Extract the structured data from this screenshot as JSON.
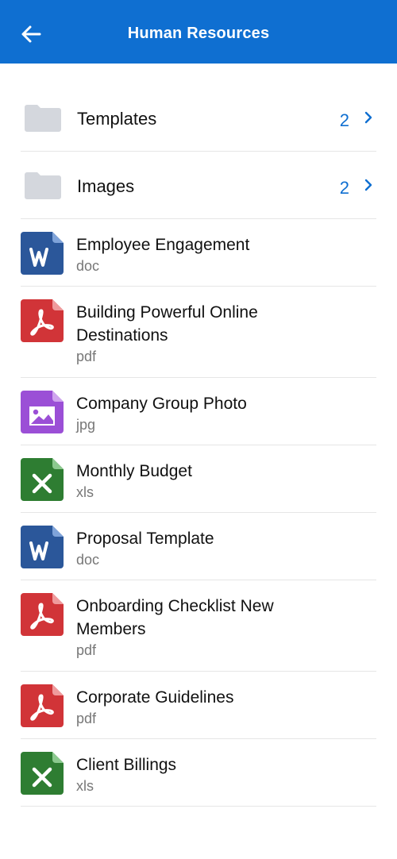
{
  "header": {
    "title": "Human Resources",
    "back_icon": "arrow-left-icon",
    "background": "#0f6fd1"
  },
  "folders": [
    {
      "name": "Templates",
      "count": "2"
    },
    {
      "name": "Images",
      "count": "2"
    }
  ],
  "files": [
    {
      "name": "Employee Engagement",
      "ext": "doc",
      "icon": "word-icon"
    },
    {
      "name": "Building Powerful Online Destinations",
      "ext": "pdf",
      "icon": "pdf-icon"
    },
    {
      "name": "Company Group Photo",
      "ext": "jpg",
      "icon": "image-icon"
    },
    {
      "name": "Monthly Budget",
      "ext": "xls",
      "icon": "excel-icon"
    },
    {
      "name": "Proposal Template",
      "ext": "doc",
      "icon": "word-icon"
    },
    {
      "name": "Onboarding Checklist New Members",
      "ext": "pdf",
      "icon": "pdf-icon"
    },
    {
      "name": "Corporate Guidelines",
      "ext": "pdf",
      "icon": "pdf-icon"
    },
    {
      "name": "Client Billings",
      "ext": "xls",
      "icon": "excel-icon"
    }
  ],
  "colors": {
    "accent": "#0f6fd1",
    "word": "#2b579a",
    "pdf": "#d13438",
    "image": "#9b4fd6",
    "excel": "#2e7d32",
    "folder": "#d4d7dd"
  }
}
